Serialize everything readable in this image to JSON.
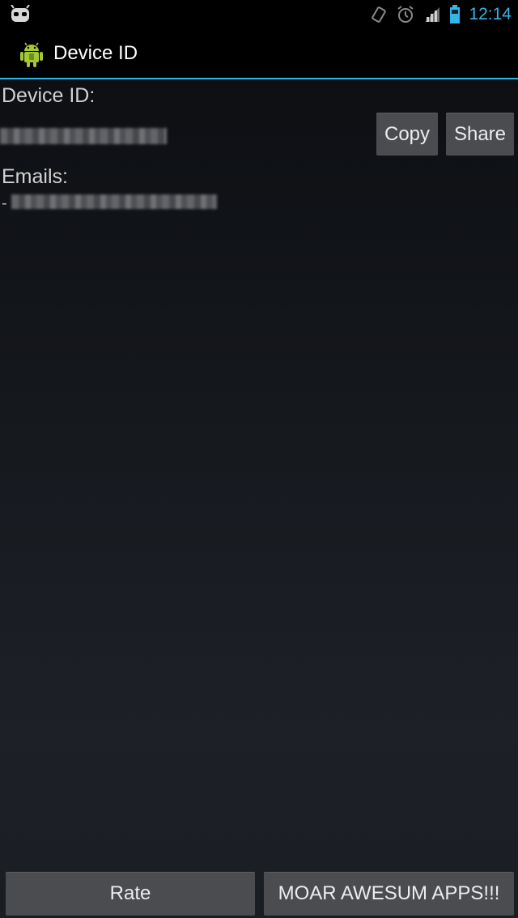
{
  "status_bar": {
    "time": "12:14",
    "icons": [
      "cyanogen-mascot-icon",
      "rotate-icon",
      "alarm-icon",
      "signal-icon",
      "battery-icon"
    ]
  },
  "action_bar": {
    "title": "Device ID",
    "icon": "android-robot-icon"
  },
  "content": {
    "device_id_label": "Device ID:",
    "emails_label": "Emails:",
    "email_prefix": "-",
    "copy_label": "Copy",
    "share_label": "Share"
  },
  "footer": {
    "rate_label": "Rate",
    "more_apps_label": "MOAR AWESUM APPS!!!"
  },
  "colors": {
    "accent": "#33b5e5",
    "android_green": "#a4c639",
    "button_bg": "#4a4c50"
  }
}
